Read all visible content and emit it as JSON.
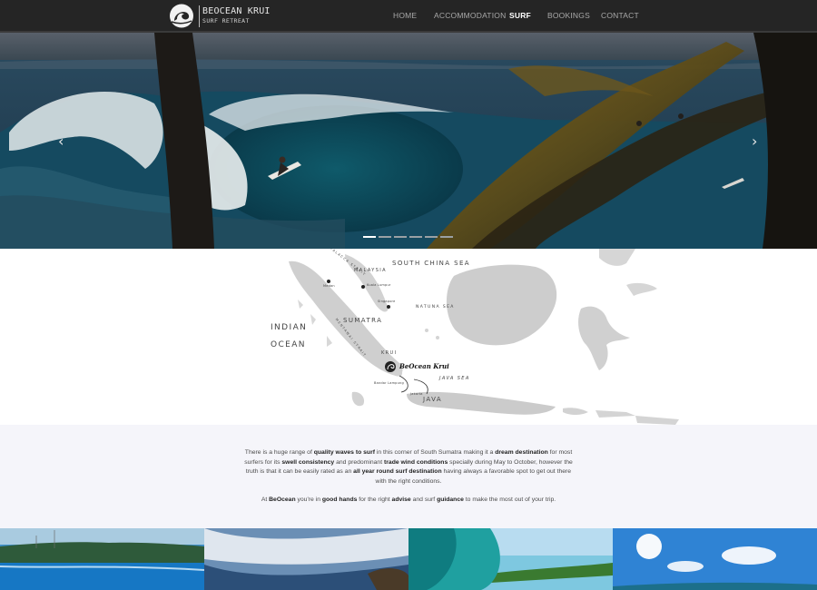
{
  "brand": {
    "name": "BEOCEAN KRUI",
    "tagline": "SURF RETREAT"
  },
  "nav": {
    "items": [
      {
        "label": "HOME",
        "active": false
      },
      {
        "label": "ACCOMMODATION",
        "active": false
      },
      {
        "label": "SURF",
        "active": true
      },
      {
        "label": "BOOKINGS",
        "active": false
      },
      {
        "label": "CONTACT",
        "active": false
      }
    ]
  },
  "slider": {
    "prev_icon": "chevron-left-icon",
    "next_icon": "chevron-right-icon",
    "slide_count": 6,
    "active_slide": 1
  },
  "map": {
    "labels": {
      "south_china_sea": "SOUTH CHINA SEA",
      "malaysia": "MALAYSIA",
      "malacca_strait": "MALACCA STRAIT",
      "medan": "Medan",
      "kuala_lumpur": "Kuala Lumpur",
      "singapore": "Singapore",
      "natuna_sea": "NATUNA SEA",
      "sumatra": "SUMATRA",
      "indian": "INDIAN",
      "ocean": "OCEAN",
      "mentawai_strait": "MENTAWAI STRAIT",
      "krui": "KRUI",
      "beocean_krui": "BeOcean Krui",
      "java_sea": "JAVA SEA",
      "bandar_lampung": "Bandar Lampung",
      "jakarta": "Jakarta",
      "java": "JAVA"
    }
  },
  "about": {
    "p1": [
      {
        "t": "There is a huge range of ",
        "b": false
      },
      {
        "t": "quality waves to surf",
        "b": true
      },
      {
        "t": " in this corner of South Sumatra making it a ",
        "b": false
      },
      {
        "t": "dream destination",
        "b": true
      },
      {
        "t": " for most surfers for its ",
        "b": false
      },
      {
        "t": "swell consistency",
        "b": true
      },
      {
        "t": " and predominant ",
        "b": false
      },
      {
        "t": "trade wind conditions",
        "b": true
      },
      {
        "t": " specially during May to October, however the truth is that it can be easily rated as an ",
        "b": false
      },
      {
        "t": "all year round surf destination",
        "b": true
      },
      {
        "t": " having always a favorable spot to get out there with the right conditions.",
        "b": false
      }
    ],
    "p2": [
      {
        "t": "At ",
        "b": false
      },
      {
        "t": "BeOcean",
        "b": true
      },
      {
        "t": " you're in ",
        "b": false
      },
      {
        "t": "good hands",
        "b": true
      },
      {
        "t": " for the right ",
        "b": false
      },
      {
        "t": "advise",
        "b": true
      },
      {
        "t": " and surf ",
        "b": false
      },
      {
        "t": "guidance",
        "b": true
      },
      {
        "t": " to make the most out of your trip.",
        "b": false
      }
    ]
  },
  "colors": {
    "nav_bg": "#252525",
    "nav_text": "#a9a9a9",
    "nav_active": "#ffffff",
    "section_bg": "#f5f5fa"
  }
}
